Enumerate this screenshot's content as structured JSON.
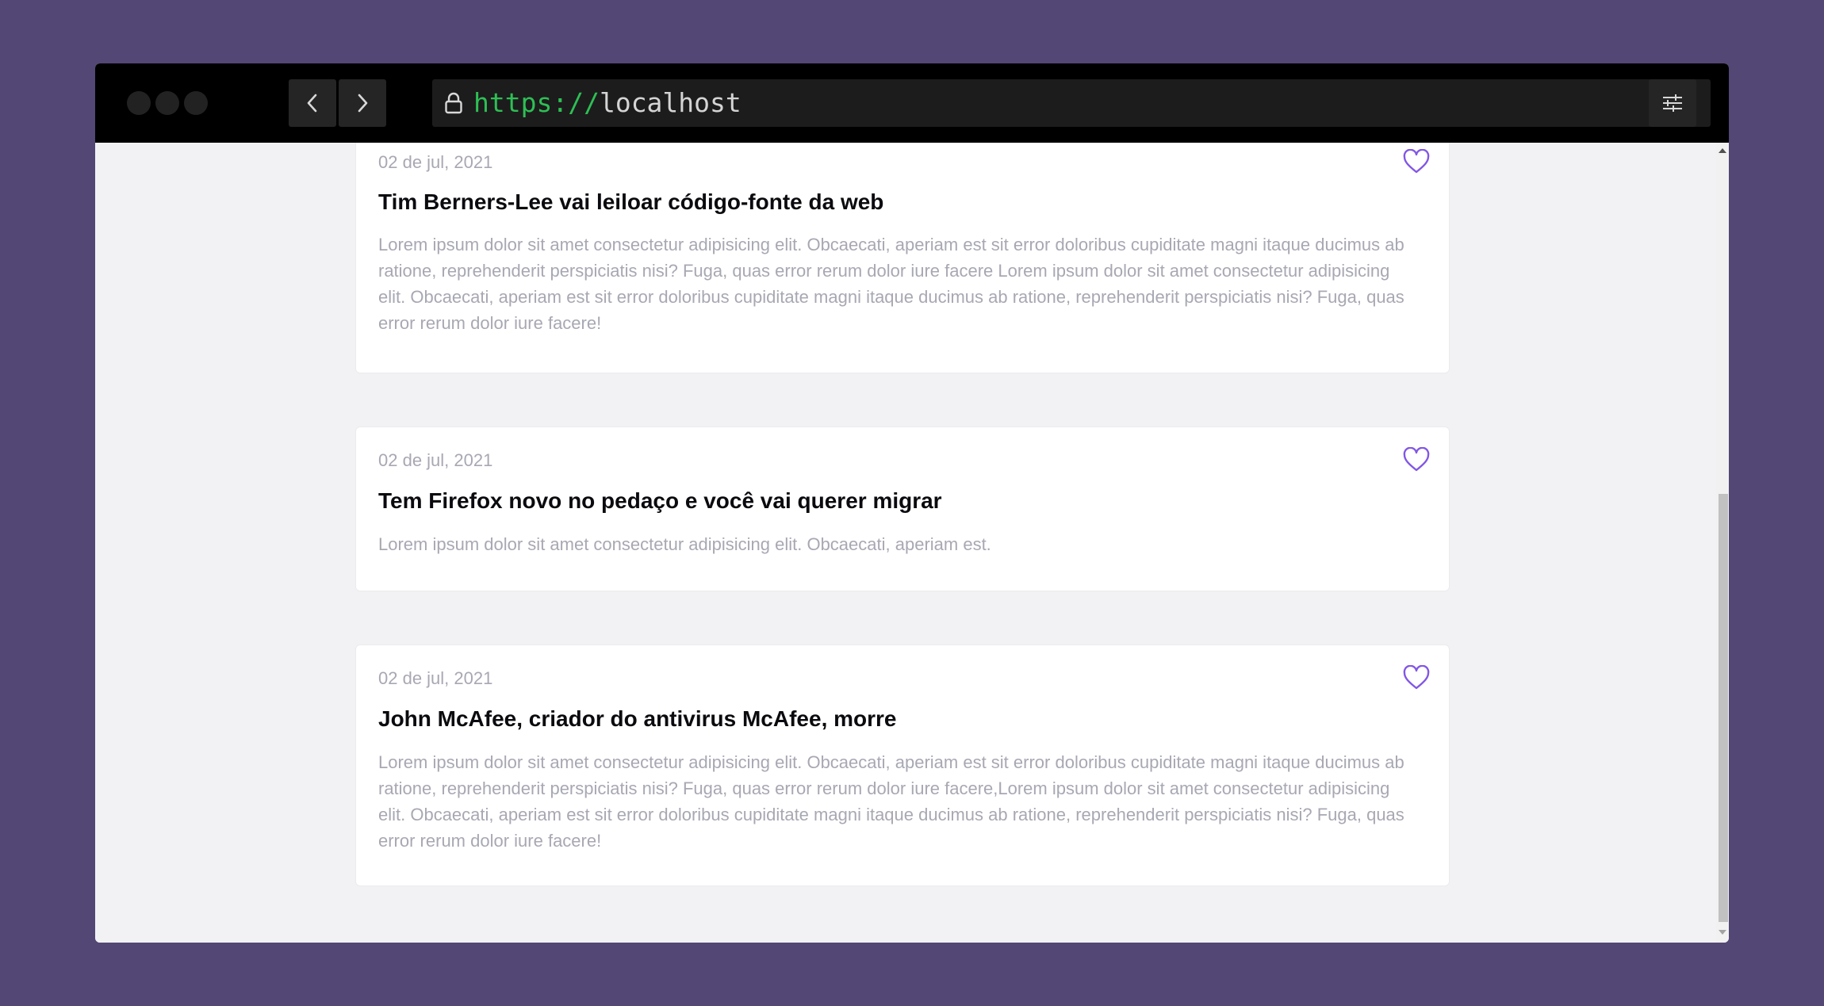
{
  "browser": {
    "url_scheme": "https://",
    "url_host": "localhost",
    "icons": {
      "back": "chevron-left-icon",
      "forward": "chevron-right-icon",
      "lock": "lock-icon",
      "settings": "sliders-icon"
    }
  },
  "posts": [
    {
      "date": "02 de jul, 2021",
      "title": "Tim Berners-Lee vai leiloar código-fonte da web",
      "excerpt": "Lorem ipsum dolor sit amet consectetur adipisicing elit. Obcaecati, aperiam est sit error doloribus cupiditate magni itaque ducimus ab ratione, reprehenderit perspiciatis nisi? Fuga, quas error rerum dolor iure facere Lorem ipsum dolor sit amet consectetur adipisicing elit. Obcaecati, aperiam est sit error doloribus cupiditate magni itaque ducimus ab ratione, reprehenderit perspiciatis nisi? Fuga, quas error rerum dolor iure facere!"
    },
    {
      "date": "02 de jul, 2021",
      "title": "Tem Firefox novo no pedaço e você vai querer migrar",
      "excerpt": "Lorem ipsum dolor sit amet consectetur adipisicing elit. Obcaecati, aperiam est."
    },
    {
      "date": "02 de jul, 2021",
      "title": "John McAfee, criador do antivirus McAfee, morre",
      "excerpt": "Lorem ipsum dolor sit amet consectetur adipisicing elit. Obcaecati, aperiam est sit error doloribus cupiditate magni itaque ducimus ab ratione, reprehenderit perspiciatis nisi? Fuga, quas error rerum dolor iure facere,Lorem ipsum dolor sit amet consectetur adipisicing elit. Obcaecati, aperiam est sit error doloribus cupiditate magni itaque ducimus ab ratione, reprehenderit perspiciatis nisi? Fuga, quas error rerum dolor iure facere!"
    }
  ],
  "colors": {
    "accent": "#8257e5",
    "page_background": "#534775",
    "muted_text": "#a8a8b3",
    "url_scheme": "#2ebf55"
  }
}
